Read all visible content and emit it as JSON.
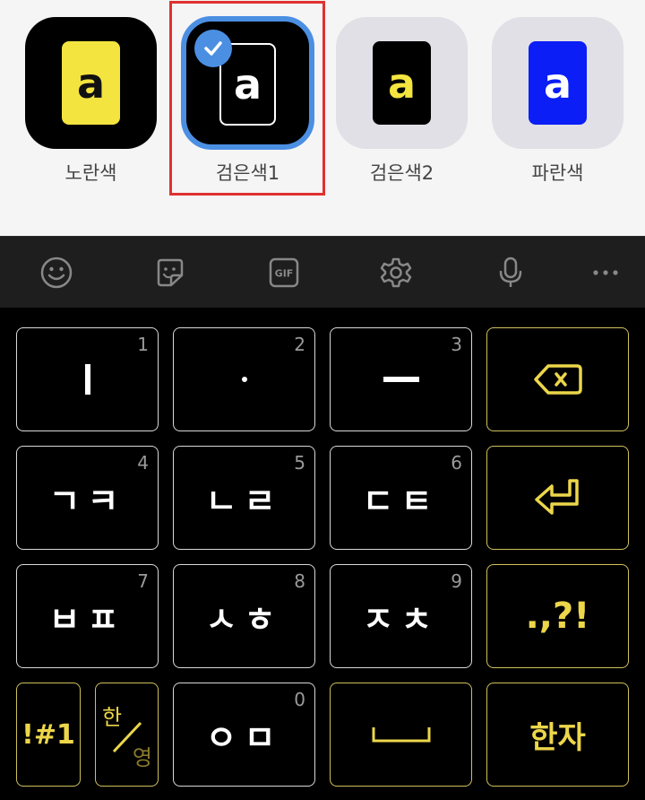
{
  "themes": [
    {
      "label": "노란색",
      "badge_letter": "a"
    },
    {
      "label": "검은색1",
      "badge_letter": "a"
    },
    {
      "label": "검은색2",
      "badge_letter": "a"
    },
    {
      "label": "파란색",
      "badge_letter": "a"
    }
  ],
  "selected_theme": "검은색1",
  "toolbar": {
    "icons": [
      "emoji-icon",
      "sticker-icon",
      "gif-icon",
      "settings-icon",
      "microphone-icon",
      "more-icon"
    ],
    "gif_text": "GIF"
  },
  "keys": {
    "row1": [
      {
        "num": "1",
        "glyph": "ㅣ"
      },
      {
        "num": "2",
        "glyph": "·"
      },
      {
        "num": "3",
        "glyph": "ㅡ"
      }
    ],
    "row2": [
      {
        "num": "4",
        "glyph": "ㄱㅋ"
      },
      {
        "num": "5",
        "glyph": "ㄴㄹ"
      },
      {
        "num": "6",
        "glyph": "ㄷㅌ"
      }
    ],
    "row3": [
      {
        "num": "7",
        "glyph": "ㅂㅍ"
      },
      {
        "num": "8",
        "glyph": "ㅅㅎ"
      },
      {
        "num": "9",
        "glyph": "ㅈㅊ"
      }
    ],
    "row4": {
      "zero_num": "0",
      "zero_glyph": "ㅇㅁ"
    },
    "punct": ".,?!",
    "symbols": "!#1",
    "lang_top": "한",
    "lang_bottom": "영",
    "hanja": "한자"
  },
  "colors": {
    "accent_yellow": "#ecd64a",
    "selected_blue": "#4b8fe3",
    "selection_red": "#e0312f",
    "blue_theme": "#0a1ef5",
    "yellow_theme": "#f3e440"
  }
}
